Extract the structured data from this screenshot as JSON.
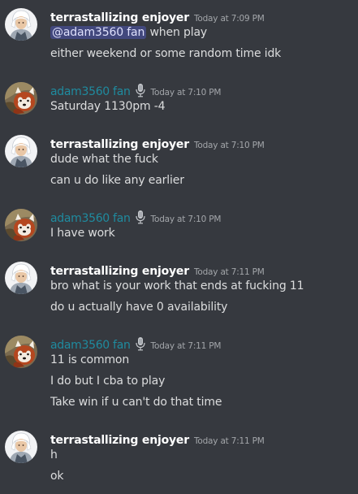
{
  "colors": {
    "background": "#36393f",
    "author_default": "#ffffff",
    "author_teal": "#1f8b9f",
    "timestamp": "#a3a6aa",
    "text": "#dcddde",
    "mention_bg": "#4a4f8a"
  },
  "messages": [
    {
      "author": "terrastallizing enjoyer",
      "timestamp": "Today at 7:09 PM",
      "avatar_icon": "white-hair-character-avatar",
      "lines": [
        "",
        "either weekend or some random time idk"
      ],
      "mention": "@adam3560 fan",
      "mention_suffix": " when play"
    },
    {
      "author": "adam3560 fan",
      "timestamp": "Today at 7:10 PM",
      "avatar_icon": "red-panda-avatar",
      "badge_icon": "microphone-icon",
      "lines": [
        "Saturday 1130pm -4"
      ]
    },
    {
      "author": "terrastallizing enjoyer",
      "timestamp": "Today at 7:10 PM",
      "avatar_icon": "white-hair-character-avatar",
      "lines": [
        "dude what the fuck",
        "can u do like any earlier"
      ]
    },
    {
      "author": "adam3560 fan",
      "timestamp": "Today at 7:10 PM",
      "avatar_icon": "red-panda-avatar",
      "badge_icon": "microphone-icon",
      "lines": [
        "I have work"
      ]
    },
    {
      "author": "terrastallizing enjoyer",
      "timestamp": "Today at 7:11 PM",
      "avatar_icon": "white-hair-character-avatar",
      "lines": [
        "bro what is your work that ends at fucking 11",
        "do u actually have 0 availability"
      ]
    },
    {
      "author": "adam3560 fan",
      "timestamp": "Today at 7:11 PM",
      "avatar_icon": "red-panda-avatar",
      "badge_icon": "microphone-icon",
      "lines": [
        "11 is common",
        "I do but I cba to play",
        "Take win if u can't do that time"
      ]
    },
    {
      "author": "terrastallizing enjoyer",
      "timestamp": "Today at 7:11 PM",
      "avatar_icon": "white-hair-character-avatar",
      "lines": [
        "h",
        "ok"
      ]
    }
  ]
}
